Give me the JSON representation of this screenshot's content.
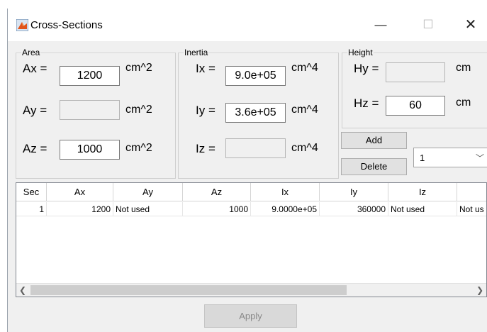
{
  "window": {
    "title": "Cross-Sections",
    "minimize_glyph": "—",
    "maximize_glyph": "☐",
    "close_glyph": "✕",
    "icon_name": "matlab-figure-icon"
  },
  "area": {
    "title": "Area",
    "ax_label": "Ax =",
    "ax_value": "1200",
    "ax_unit": "cm^2",
    "ay_label": "Ay =",
    "ay_value": "",
    "ay_unit": "cm^2",
    "az_label": "Az =",
    "az_value": "1000",
    "az_unit": "cm^2"
  },
  "inertia": {
    "title": "Inertia",
    "ix_label": "Ix =",
    "ix_value": "9.0e+05",
    "ix_unit": "cm^4",
    "iy_label": "Iy =",
    "iy_value": "3.6e+05",
    "iy_unit": "cm^4",
    "iz_label": "Iz =",
    "iz_value": "",
    "iz_unit": "cm^4"
  },
  "height": {
    "title": "Height",
    "hy_label": "Hy =",
    "hy_value": "",
    "hy_unit": "cm",
    "hz_label": "Hz =",
    "hz_value": "60",
    "hz_unit": "cm"
  },
  "buttons": {
    "add": "Add",
    "delete": "Delete",
    "apply": "Apply"
  },
  "section_select": {
    "selected": "1"
  },
  "table": {
    "columns": [
      "Sec",
      "Ax",
      "Ay",
      "Az",
      "Ix",
      "Iy",
      "Iz",
      ""
    ],
    "rows": [
      [
        "1",
        "1200",
        "Not used",
        "1000",
        "9.0000e+05",
        "360000",
        "Not used",
        "Not us"
      ]
    ]
  },
  "colors": {
    "window_bg": "#f0f0f0",
    "button_bg": "#e1e1e1",
    "disabled_field": "#f0f0f0"
  }
}
